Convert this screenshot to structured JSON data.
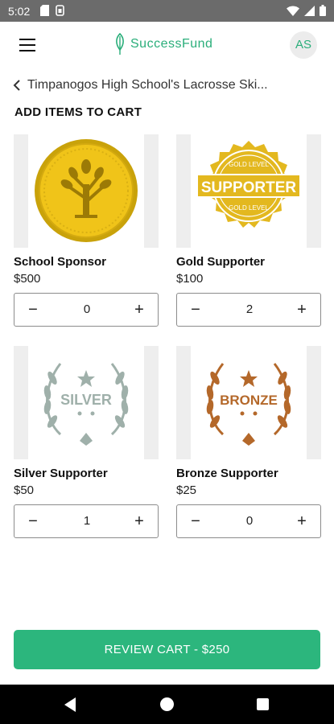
{
  "status_bar": {
    "time": "5:02"
  },
  "app_bar": {
    "brand_name": "SuccessFund",
    "avatar_initials": "AS",
    "brand_color": "#2aae7a"
  },
  "breadcrumb": {
    "campaign_title": "Timpanogos High School's Lacrosse Ski..."
  },
  "section_title": "ADD ITEMS TO CART",
  "items": [
    {
      "name": "School Sponsor",
      "price": "$500",
      "quantity": "0",
      "badge_icon": "gold-tree-coin-icon"
    },
    {
      "name": "Gold Supporter",
      "price": "$100",
      "quantity": "2",
      "badge_icon": "gold-supporter-seal-icon",
      "badge_text": "SUPPORTER",
      "badge_subtext": "GOLD LEVEL"
    },
    {
      "name": "Silver Supporter",
      "price": "$50",
      "quantity": "1",
      "badge_icon": "silver-laurel-icon",
      "badge_text": "SILVER"
    },
    {
      "name": "Bronze Supporter",
      "price": "$25",
      "quantity": "0",
      "badge_icon": "bronze-laurel-icon",
      "badge_text": "BRONZE"
    }
  ],
  "stepper": {
    "minus": "−",
    "plus": "+"
  },
  "cta": {
    "label": "REVIEW CART - $250",
    "color": "#2cb67d"
  }
}
